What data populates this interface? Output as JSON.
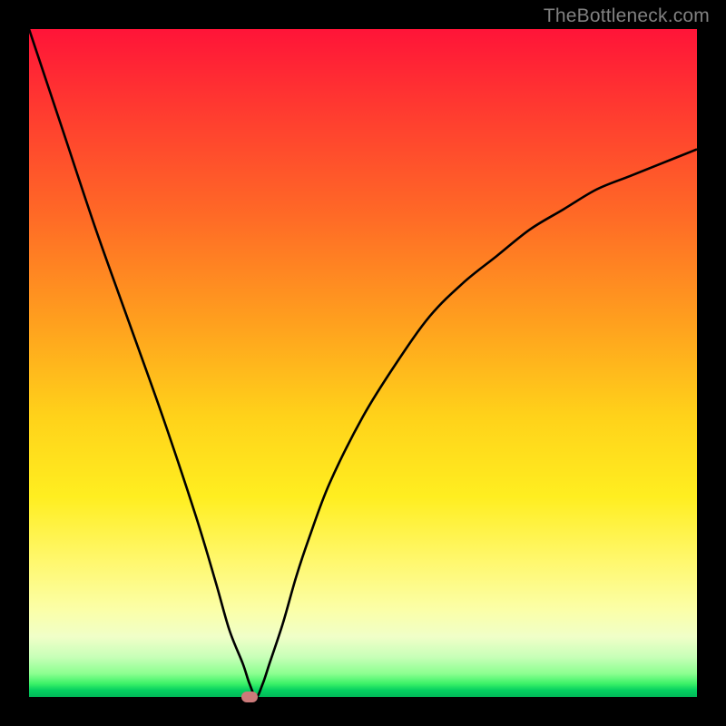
{
  "attribution": "TheBottleneck.com",
  "colors": {
    "frame": "#000000",
    "gradient_top": "#ff1438",
    "gradient_bottom": "#00b858",
    "curve": "#000000",
    "marker": "#cc7a7a"
  },
  "chart_data": {
    "type": "line",
    "title": "",
    "xlabel": "",
    "ylabel": "",
    "xlim": [
      0,
      100
    ],
    "ylim": [
      0,
      100
    ],
    "grid": false,
    "legend": false,
    "annotations": [
      {
        "text": "TheBottleneck.com",
        "position": "top-right"
      }
    ],
    "series": [
      {
        "name": "bottleneck-curve",
        "x": [
          0,
          5,
          10,
          15,
          20,
          25,
          28,
          30,
          32,
          33,
          34,
          35,
          36,
          38,
          40,
          42,
          45,
          50,
          55,
          60,
          65,
          70,
          75,
          80,
          85,
          90,
          95,
          100
        ],
        "values": [
          100,
          85,
          70,
          56,
          42,
          27,
          17,
          10,
          5,
          2,
          0,
          2,
          5,
          11,
          18,
          24,
          32,
          42,
          50,
          57,
          62,
          66,
          70,
          73,
          76,
          78,
          80,
          82
        ]
      }
    ],
    "marker": {
      "x": 33,
      "y": 0
    },
    "background_gradient": {
      "direction": "vertical",
      "stops": [
        {
          "pct": 0,
          "color": "#ff1438"
        },
        {
          "pct": 28,
          "color": "#ff6a26"
        },
        {
          "pct": 58,
          "color": "#ffd21a"
        },
        {
          "pct": 80,
          "color": "#fff870"
        },
        {
          "pct": 94,
          "color": "#c8ffb8"
        },
        {
          "pct": 100,
          "color": "#00b858"
        }
      ]
    }
  }
}
